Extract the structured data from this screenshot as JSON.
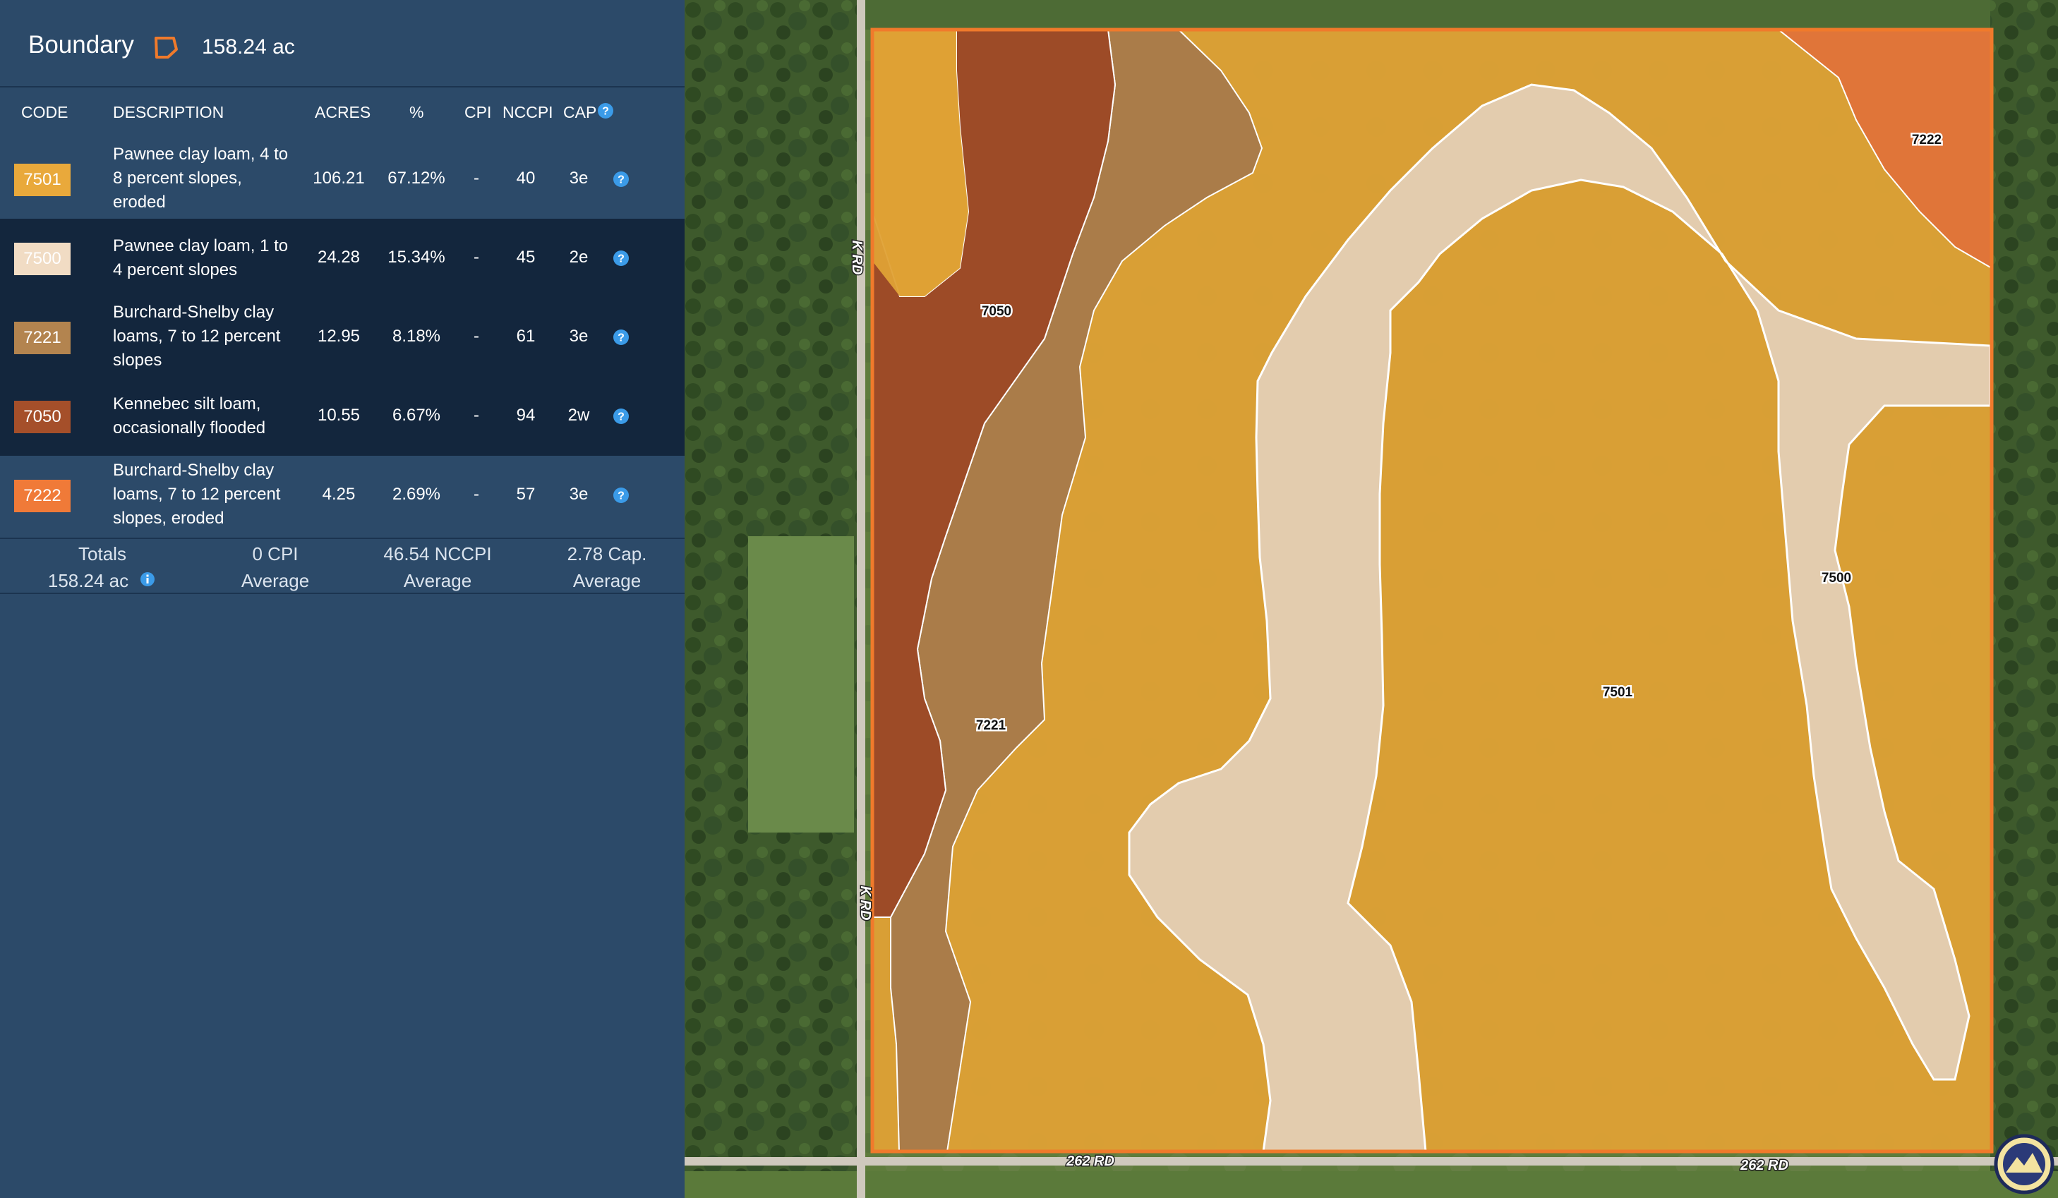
{
  "boundary": {
    "title": "Boundary",
    "acres": "158.24 ac",
    "outline_color": "#f07a2b"
  },
  "table": {
    "headers": {
      "code": "CODE",
      "description": "DESCRIPTION",
      "acres": "ACRES",
      "percent": "%",
      "cpi": "CPI",
      "nccpi": "NCCPI",
      "cap": "CAP"
    },
    "rows": [
      {
        "code": "7501",
        "color": "#e9a93b",
        "description": "Pawnee clay loam, 4 to 8 percent slopes, eroded",
        "acres": "106.21",
        "percent": "67.12%",
        "cpi": "-",
        "nccpi": "40",
        "cap": "3e"
      },
      {
        "code": "7500",
        "color": "#f1dcc4",
        "description": "Pawnee clay loam, 1 to 4 percent slopes",
        "acres": "24.28",
        "percent": "15.34%",
        "cpi": "-",
        "nccpi": "45",
        "cap": "2e"
      },
      {
        "code": "7221",
        "color": "#b3844f",
        "description": "Burchard-Shelby clay loams, 7 to 12 percent slopes",
        "acres": "12.95",
        "percent": "8.18%",
        "cpi": "-",
        "nccpi": "61",
        "cap": "3e"
      },
      {
        "code": "7050",
        "color": "#a54f2a",
        "description": "Kennebec silt loam, occasionally flooded",
        "acres": "10.55",
        "percent": "6.67%",
        "cpi": "-",
        "nccpi": "94",
        "cap": "2w"
      },
      {
        "code": "7222",
        "color": "#f07a38",
        "description": "Burchard-Shelby clay loams, 7 to 12 percent slopes, eroded",
        "acres": "4.25",
        "percent": "2.69%",
        "cpi": "-",
        "nccpi": "57",
        "cap": "3e"
      }
    ]
  },
  "totals": {
    "label": "Totals",
    "acres": "158.24 ac",
    "cpi_value": "0 CPI",
    "cpi_sub": "Average",
    "nccpi_value": "46.54 NCCPI",
    "nccpi_sub": "Average",
    "cap_value": "2.78 Cap.",
    "cap_sub": "Average"
  },
  "map": {
    "soil_labels": [
      "7050",
      "7221",
      "7222",
      "7500",
      "7501"
    ],
    "road_labels": [
      "K RD",
      "K RD",
      "262 RD",
      "262 RD"
    ],
    "polygon_colors": {
      "7501": "#dfa135",
      "7500": "#e4cfb5",
      "7221": "#a87a4b",
      "7050": "#9a4727",
      "7222": "#e0733a"
    }
  },
  "icons": {
    "boundary": "boundary-polygon-icon",
    "help": "question-circle-icon",
    "info": "info-circle-icon",
    "logo": "county-seal-logo"
  }
}
